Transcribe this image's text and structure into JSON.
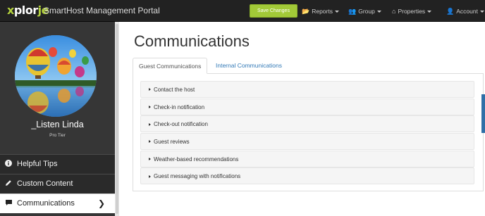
{
  "navbar": {
    "logo": {
      "part1": "x",
      "part2": "plor",
      "part3": "je"
    },
    "title": "SmartHost Management Portal",
    "save_label": "Save Changes",
    "reports_label": "Reports",
    "group_label": "Group",
    "properties_label": "Properties",
    "account_label": "Account"
  },
  "sidebar": {
    "user_name": "_Listen Linda",
    "tier": "Pro Tier",
    "items": [
      {
        "label": "Helpful Tips",
        "icon": "info-icon"
      },
      {
        "label": "Custom Content",
        "icon": "pencil-icon"
      },
      {
        "label": "Communications",
        "icon": "comment-icon",
        "active": true
      }
    ]
  },
  "main": {
    "title": "Communications",
    "tabs": [
      {
        "label": "Guest Communications",
        "active": true
      },
      {
        "label": "Internal Communications",
        "active": false
      }
    ],
    "accordion": [
      "Contact the host",
      "Check-in notification",
      "Check-out notification",
      "Guest reviews",
      "Weather-based recommendations",
      "Guest messaging with notifications"
    ]
  },
  "colors": {
    "navbar_bg": "#222222",
    "accent_green": "#a2c938",
    "sidebar_bg": "#363636",
    "link_blue": "#337ab7"
  }
}
